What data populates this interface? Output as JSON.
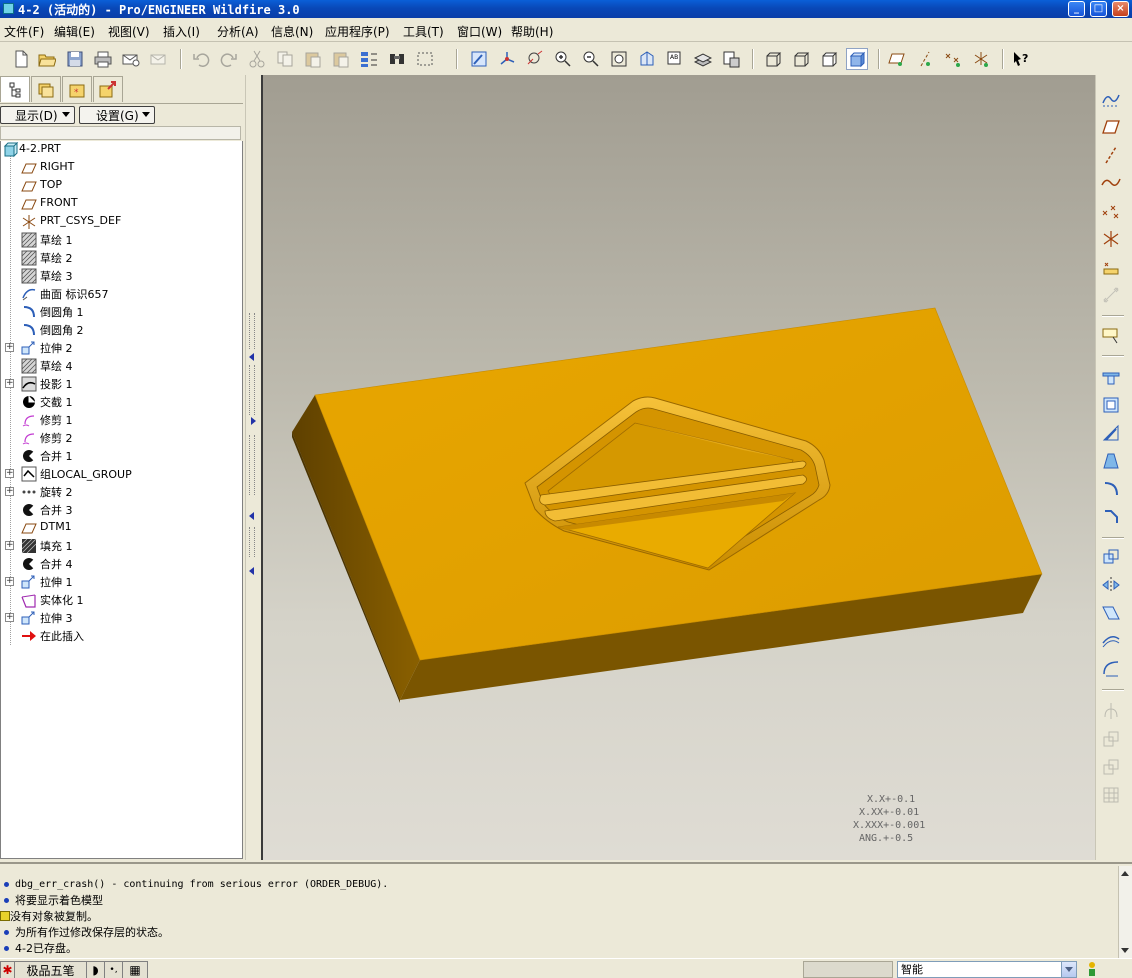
{
  "window": {
    "title": "4-2 (活动的) - Pro/ENGINEER Wildfire 3.0",
    "minimize_glyph": "_",
    "maximize_glyph": "□",
    "close_glyph": "×"
  },
  "menu": [
    {
      "label": "文件(F)"
    },
    {
      "label": "编辑(E)"
    },
    {
      "label": "视图(V)"
    },
    {
      "label": "插入(I)"
    },
    {
      "label": "分析(A)"
    },
    {
      "label": "信息(N)"
    },
    {
      "label": "应用程序(P)"
    },
    {
      "label": "工具(T)"
    },
    {
      "label": "窗口(W)"
    },
    {
      "label": "帮助(H)"
    }
  ],
  "toolbar_icons": [
    "new-file-icon",
    "open-folder-icon",
    "save-icon",
    "print-icon",
    "email-icon",
    "email-link-icon",
    "undo-icon",
    "redo-icon",
    "cut-icon",
    "copy-icon",
    "paste-icon",
    "paste-special-icon",
    "regenerate-icon",
    "find-icon",
    "select-box-icon",
    "repaint-icon",
    "spin-center-icon",
    "orient-icon",
    "zoom-in-icon",
    "zoom-out-icon",
    "refit-icon",
    "reorient-icon",
    "saved-views-icon",
    "layers-icon",
    "view-manager-icon",
    "wireframe-icon",
    "hidden-line-icon",
    "no-hidden-icon",
    "shading-icon",
    "datum-planes-toggle-icon",
    "datum-axes-toggle-icon",
    "datum-points-toggle-icon",
    "csys-toggle-icon",
    "context-help-icon"
  ],
  "left_panel": {
    "tabs": [
      "model-tree-icon",
      "folder-browser-icon",
      "favorites-icon",
      "connections-icon"
    ],
    "show_button": "显示(D)",
    "settings_button": "设置(G)",
    "tree": [
      {
        "label": "4-2.PRT",
        "icon": "part-icon",
        "expander": ""
      },
      {
        "label": "RIGHT",
        "icon": "datum-plane-icon",
        "expander": ""
      },
      {
        "label": "TOP",
        "icon": "datum-plane-icon",
        "expander": ""
      },
      {
        "label": "FRONT",
        "icon": "datum-plane-icon",
        "expander": ""
      },
      {
        "label": "PRT_CSYS_DEF",
        "icon": "csys-icon",
        "expander": ""
      },
      {
        "label": "草绘 1",
        "icon": "sketch-icon",
        "expander": ""
      },
      {
        "label": "草绘 2",
        "icon": "sketch-icon",
        "expander": ""
      },
      {
        "label": "草绘 3",
        "icon": "sketch-icon",
        "expander": ""
      },
      {
        "label": "曲面 标识657",
        "icon": "surface-icon",
        "expander": ""
      },
      {
        "label": "倒圆角 1",
        "icon": "round-icon",
        "expander": ""
      },
      {
        "label": "倒圆角 2",
        "icon": "round-icon",
        "expander": ""
      },
      {
        "label": "拉伸 2",
        "icon": "extrude-icon",
        "expander": "+"
      },
      {
        "label": "草绘 4",
        "icon": "sketch-icon",
        "expander": ""
      },
      {
        "label": "投影 1",
        "icon": "projection-icon",
        "expander": "+"
      },
      {
        "label": "交截 1",
        "icon": "intersect-icon",
        "expander": ""
      },
      {
        "label": "修剪 1",
        "icon": "trim-icon",
        "expander": ""
      },
      {
        "label": "修剪 2",
        "icon": "trim-icon",
        "expander": ""
      },
      {
        "label": "合并 1",
        "icon": "merge-icon",
        "expander": ""
      },
      {
        "label": "组LOCAL_GROUP",
        "icon": "group-icon",
        "expander": "+"
      },
      {
        "label": "旋转 2",
        "icon": "revolve-icon",
        "expander": "+"
      },
      {
        "label": "合并 3",
        "icon": "merge-icon",
        "expander": ""
      },
      {
        "label": "DTM1",
        "icon": "datum-plane-icon",
        "expander": ""
      },
      {
        "label": "填充 1",
        "icon": "fill-icon",
        "expander": "+"
      },
      {
        "label": "合并 4",
        "icon": "merge-icon",
        "expander": ""
      },
      {
        "label": "拉伸 1",
        "icon": "extrude-icon",
        "expander": "+"
      },
      {
        "label": "实体化 1",
        "icon": "solidify-icon",
        "expander": ""
      },
      {
        "label": "拉伸 3",
        "icon": "extrude-icon",
        "expander": "+"
      },
      {
        "label": "在此插入",
        "icon": "insert-here-arrow-icon",
        "expander": ""
      }
    ]
  },
  "viewport": {
    "tolerances": [
      "X.X+-0.1",
      "X.XX+-0.01",
      "X.XXX+-0.001",
      "ANG.+-0.5"
    ],
    "model_color": "#e5a200"
  },
  "right_toolbar": [
    "sketched-datum-curve-icon",
    "datum-plane-icon",
    "datum-axis-icon",
    "datum-curve-icon",
    "datum-point-icon",
    "datum-csys-icon",
    "datum-analysis-icon",
    "disabled-link-icon",
    "annotation-icon",
    "hole-icon",
    "shell-icon",
    "rib-icon",
    "draft-icon",
    "round-tool-icon",
    "chamfer-tool-icon",
    "copy-feature-icon",
    "mirror-icon",
    "merge-tool-icon",
    "trim-tool-icon",
    "thicken-icon",
    "pattern-icon",
    "solidify-tool-icon",
    "offset-icon",
    "intersect-tool-icon"
  ],
  "messages": [
    {
      "type": "info",
      "text": "dbg_err_crash() - continuing from serious error (ORDER_DEBUG)."
    },
    {
      "type": "info",
      "text": "将要显示着色模型"
    },
    {
      "type": "warning",
      "text": "没有对象被复制。"
    },
    {
      "type": "info",
      "text": "为所有作过修改保存层的状态。"
    },
    {
      "type": "info",
      "text": "4-2已存盘。"
    }
  ],
  "status": {
    "ime_name": "极品五笔",
    "filter_value": "智能"
  }
}
